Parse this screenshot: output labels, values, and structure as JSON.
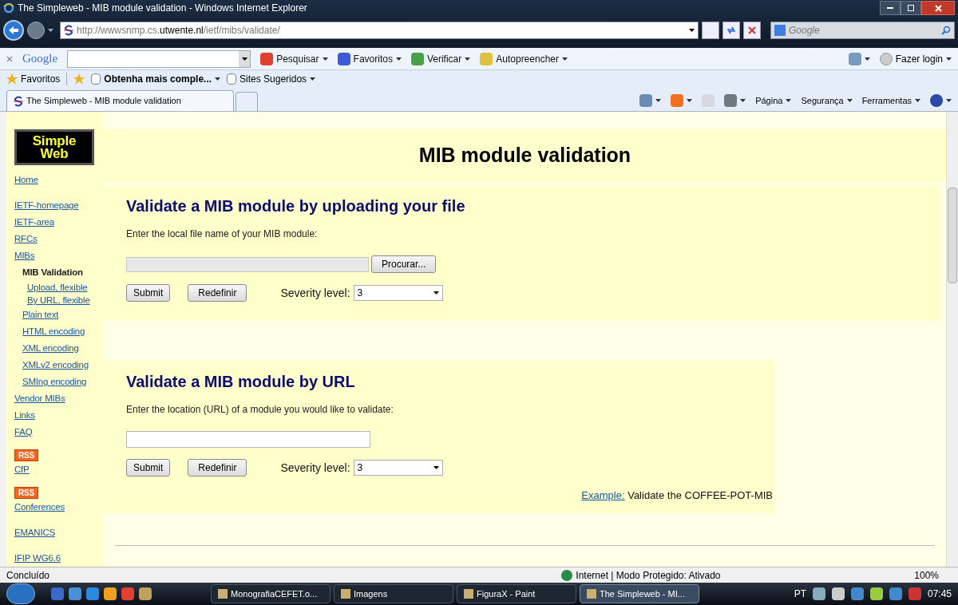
{
  "window": {
    "title": "The Simpleweb - MIB module validation - Windows Internet Explorer"
  },
  "address": {
    "url_prefix": "http://wwwsnmp.cs.",
    "url_host": "utwente.nl",
    "url_path": "/ietf/mibs/validate/"
  },
  "search_box": {
    "placeholder": "Google"
  },
  "google_toolbar": {
    "logo": "Google",
    "items": [
      {
        "label": "Pesquisar"
      },
      {
        "label": "Favoritos"
      },
      {
        "label": "Verificar"
      },
      {
        "label": "Autopreencher"
      }
    ],
    "login": "Fazer login"
  },
  "favorites_bar": {
    "favorites": "Favoritos",
    "items": [
      {
        "label": "Obtenha mais comple...",
        "bold": true
      },
      {
        "label": "Sites Sugeridos",
        "bold": false
      }
    ]
  },
  "tabs": [
    {
      "label": "The Simpleweb - MIB module validation",
      "selected": true
    }
  ],
  "command_bar": [
    "Página",
    "Segurança",
    "Ferramentas"
  ],
  "page": {
    "logo": [
      "Simple",
      "Web"
    ],
    "heading": "MIB module validation",
    "sidebar": [
      {
        "label": "Home",
        "kind": "link",
        "gap": true
      },
      {
        "label": "IETF-homepage",
        "kind": "link"
      },
      {
        "label": "IETF-area",
        "kind": "link"
      },
      {
        "label": "RFCs",
        "kind": "link"
      },
      {
        "label": "MIBs",
        "kind": "link",
        "children": [
          {
            "label": "MIB Validation",
            "kind": "current",
            "children": [
              {
                "label": "Upload, flexible",
                "kind": "link"
              },
              {
                "label": "By URL, flexible",
                "kind": "link"
              }
            ]
          },
          {
            "label": "Plain text",
            "kind": "link"
          },
          {
            "label": "HTML encoding",
            "kind": "link"
          },
          {
            "label": "XML encoding",
            "kind": "link"
          },
          {
            "label": "XMLv2 encoding",
            "kind": "link"
          },
          {
            "label": "SMIng encoding",
            "kind": "link"
          }
        ]
      },
      {
        "label": "Vendor MIBs",
        "kind": "link"
      },
      {
        "label": "Links",
        "kind": "link"
      },
      {
        "label": "FAQ",
        "kind": "link",
        "gap": true
      },
      {
        "label": "CfP",
        "kind": "rss",
        "badge": "RSS",
        "gap": true
      },
      {
        "label": "Conferences",
        "kind": "rss",
        "badge": "RSS",
        "gap": true
      },
      {
        "label": "EMANICS",
        "kind": "link",
        "gap": true
      },
      {
        "label": "IFIP WG6.6",
        "kind": "link"
      }
    ],
    "sections": [
      {
        "kind": "file",
        "wide": true,
        "heading": "Validate a MIB module by uploading your file",
        "prompt": "Enter the local file name of your MIB module:",
        "browse": "Procurar...",
        "submit": "Submit",
        "reset": "Redefinir",
        "severity_label": "Severity level:",
        "severity": "3"
      },
      {
        "kind": "url",
        "wide": false,
        "heading": "Validate a MIB module by URL",
        "prompt": "Enter the location (URL) of a module you would like to validate:",
        "submit": "Submit",
        "reset": "Redefinir",
        "severity_label": "Severity level:",
        "severity": "3",
        "example_link": "Example:",
        "example_text": "Validate the COFFEE-POT-MIB"
      }
    ]
  },
  "status_bar": {
    "text": "Concluído",
    "zone": "Internet | Modo Protegido: Ativado",
    "zoom": "100%"
  },
  "taskbar": {
    "buttons": [
      {
        "label": "MonografiaCEFET.o...",
        "selected": false
      },
      {
        "label": "Imagens",
        "selected": false
      },
      {
        "label": "FiguraX - Paint",
        "selected": false
      },
      {
        "label": "The Simpleweb - MI...",
        "selected": true
      }
    ],
    "language": "PT",
    "time": "07:45"
  }
}
